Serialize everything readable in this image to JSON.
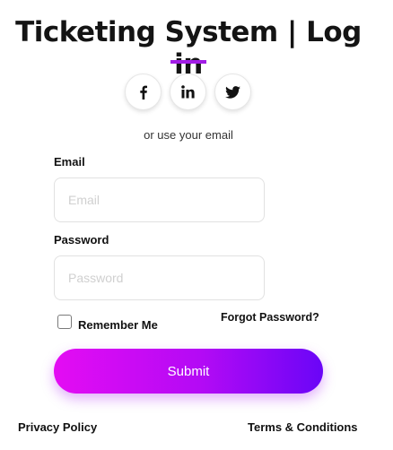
{
  "header": {
    "title": "Ticketing System | Log in",
    "accent_color": "#a21de6"
  },
  "social": {
    "buttons": [
      {
        "name": "facebook",
        "icon": "facebook-icon"
      },
      {
        "name": "linkedin",
        "icon": "linkedin-icon"
      },
      {
        "name": "twitter",
        "icon": "twitter-icon"
      }
    ],
    "alt_text": "or use your email"
  },
  "form": {
    "email": {
      "label": "Email",
      "placeholder": "Email",
      "value": ""
    },
    "password": {
      "label": "Password",
      "placeholder": "Password",
      "value": ""
    },
    "remember_label": "Remember Me",
    "remember_checked": false,
    "forgot_label": "Forgot Password?",
    "submit_label": "Submit",
    "submit_gradient": [
      "#e40cf3",
      "#b30af5",
      "#6a05f7"
    ]
  },
  "footer": {
    "privacy_label": "Privacy Policy",
    "terms_label": "Terms & Conditions"
  }
}
